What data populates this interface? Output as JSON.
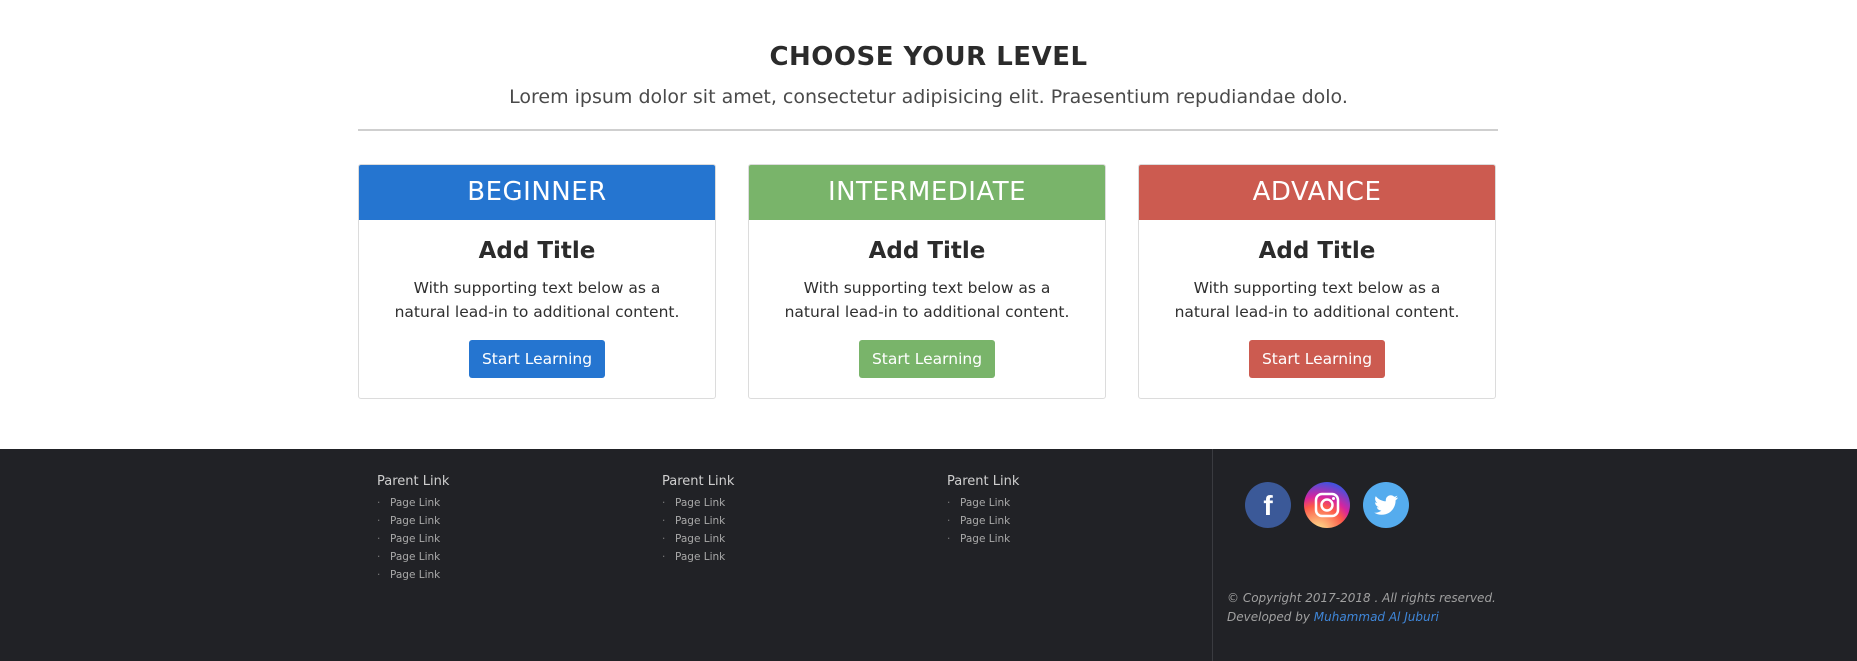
{
  "header": {
    "title": "CHOOSE YOUR LEVEL",
    "subtitle": "Lorem ipsum dolor sit amet, consectetur adipisicing elit. Praesentium repudiandae dolo."
  },
  "cards": [
    {
      "level": "BEGINNER",
      "title": "Add Title",
      "text": "With supporting text below as a natural lead-in to additional content.",
      "button": "Start Learning",
      "color": "#2575d0"
    },
    {
      "level": "INTERMEDIATE",
      "title": "Add Title",
      "text": "With supporting text below as a natural lead-in to additional content.",
      "button": "Start Learning",
      "color": "#79b46a"
    },
    {
      "level": "ADVANCE",
      "title": "Add Title",
      "text": "With supporting text below as a natural lead-in to additional content.",
      "button": "Start Learning",
      "color": "#cc5b50"
    }
  ],
  "footer": {
    "columns": [
      {
        "parent": "Parent Link",
        "links": [
          "Page Link",
          "Page Link",
          "Page Link",
          "Page Link",
          "Page Link"
        ]
      },
      {
        "parent": "Parent Link",
        "links": [
          "Page Link",
          "Page Link",
          "Page Link",
          "Page Link"
        ]
      },
      {
        "parent": "Parent Link",
        "links": [
          "Page Link",
          "Page Link",
          "Page Link"
        ]
      }
    ],
    "social": [
      {
        "icon": "facebook-icon",
        "color": "#3b5998"
      },
      {
        "icon": "instagram-icon",
        "color": "#d6366e"
      },
      {
        "icon": "twitter-icon",
        "color": "#55acee"
      }
    ],
    "copyright": "© Copyright 2017-2018 . All rights reserved.",
    "developed_prefix": "Developed by",
    "developer": "Muhammad Al Juburi"
  }
}
